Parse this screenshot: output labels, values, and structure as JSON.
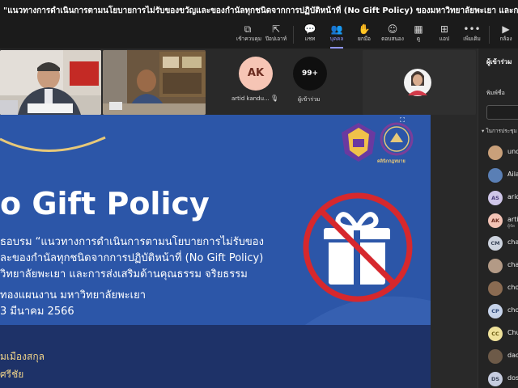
{
  "window": {
    "title": "\"แนวทางการดำเนินการตามนโยบายการไม่รับของขวัญและของกำนัลทุกชนิดจากการปฏิบัติหน้าที่ (No Gift Policy) ของมหาวิทยาลัยพะเยา และการส่งเสริมด้านคุณธรรม จริยธรรม ของบุคลากร"
  },
  "toolbar": {
    "items": [
      {
        "name": "join-button",
        "label": "เข้าควบคุม",
        "icon": "⧉"
      },
      {
        "name": "popout-button",
        "label": "ป๊อปเอาท์",
        "icon": "⇱"
      },
      {
        "name": "chat-button",
        "label": "แชท",
        "icon": "💬"
      },
      {
        "name": "people-button",
        "label": "บุคคล",
        "icon": "👥"
      },
      {
        "name": "raise-hand-button",
        "label": "ยกมือ",
        "icon": "✋"
      },
      {
        "name": "react-button",
        "label": "ตอบสนอง",
        "icon": "☺"
      },
      {
        "name": "view-button",
        "label": "ดู",
        "icon": "▦"
      },
      {
        "name": "apps-button",
        "label": "แอป",
        "icon": "⊞"
      },
      {
        "name": "more-button",
        "label": "เพิ่มเติม",
        "icon": "•••"
      },
      {
        "name": "camera-button",
        "label": "กล้อง",
        "icon": "▶"
      }
    ]
  },
  "participants_strip": {
    "ak_initials": "AK",
    "ak_name": "artid kandu...",
    "overflow_count": "99+",
    "overflow_label": "ผู้เข้าร่วม"
  },
  "slide": {
    "heading": "o Gift Policy",
    "line1": "ธอบรม “แนวทางการดำเนินการตามนโยบายการไม่รับของ",
    "line2": "ละของกำนัลทุกชนิดจากการปฏิบัติหน้าที่ (No Gift Policy)",
    "line3": "วิทยาลัยพะเยา และการส่งเสริมด้านคุณธรรม จริยธรรม",
    "line4": "ทองแผนงาน มหาวิทยาลัยพะเยา",
    "line5": "3 มีนาคม 2566",
    "bottom1": "มเมืองสกุล",
    "bottom2": "ศรีชัย",
    "logo2_label": "คลินิกกฎหมาย"
  },
  "panel": {
    "title": "ผู้เข้าร่วม",
    "search_hint": "พิมพ์ชื่อ",
    "section": "ในการประชุม",
    "rows": [
      {
        "initials": "",
        "name": "unc",
        "sub": "",
        "color": "#c9a07a"
      },
      {
        "initials": "",
        "name": "Aila",
        "sub": "",
        "color": "#5a7fb5"
      },
      {
        "initials": "AS",
        "name": "arid",
        "sub": "",
        "color": "#cfc6e8"
      },
      {
        "initials": "AK",
        "name": "artid",
        "sub": "ผู้จัด",
        "color": "#f3c3b5"
      },
      {
        "initials": "CM",
        "name": "chat",
        "sub": "",
        "color": "#cdd3de"
      },
      {
        "initials": "",
        "name": "chat",
        "sub": "",
        "color": "#b39a86"
      },
      {
        "initials": "",
        "name": "cho",
        "sub": "",
        "color": "#8a6b52"
      },
      {
        "initials": "CP",
        "name": "cho",
        "sub": "",
        "color": "#c6d3ea"
      },
      {
        "initials": "CC",
        "name": "Chu",
        "sub": "",
        "color": "#efe19a"
      },
      {
        "initials": "",
        "name": "dao",
        "sub": "",
        "color": "#6d5a48"
      },
      {
        "initials": "DS",
        "name": "dos",
        "sub": "",
        "color": "#c7cde0"
      }
    ]
  }
}
